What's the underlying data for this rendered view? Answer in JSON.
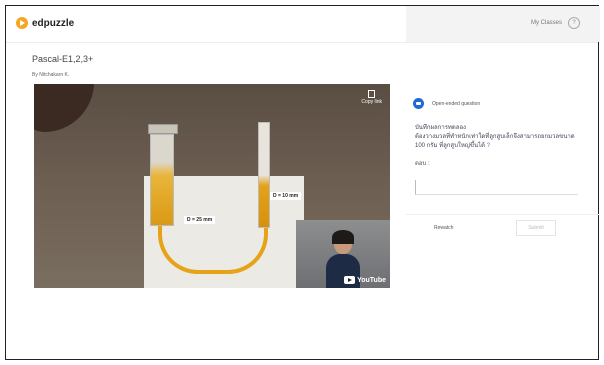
{
  "header": {
    "logo_text": "edpuzzle",
    "my_classes": "My Classes",
    "help_label": "?"
  },
  "video": {
    "title": "Pascal-E1,2,3+",
    "byline": "By Nitchakarn K.",
    "copy_link": "Copy link",
    "label_small": "D = 10 mm",
    "label_big": "D = 25 mm",
    "youtube": "YouTube"
  },
  "question": {
    "type_label": "Open-ended question",
    "heading": "บันทึกผลการทดลอง",
    "text": "ต้องวางมวลที่ทำหนักเท่าใดที่ลูกสูบเล็กจึงสามารถยกมวลขนาด 100 กรัม ที่ลูกสูบใหญ่ขึ้นได้",
    "link_mark": "?",
    "answer_label": "ตอบ :",
    "answer_value": "",
    "rewatch": "Rewatch",
    "submit": "Submit"
  },
  "colors": {
    "brand": "#f5a623",
    "accent": "#1e6ad6",
    "liquid": "#e6a317"
  }
}
